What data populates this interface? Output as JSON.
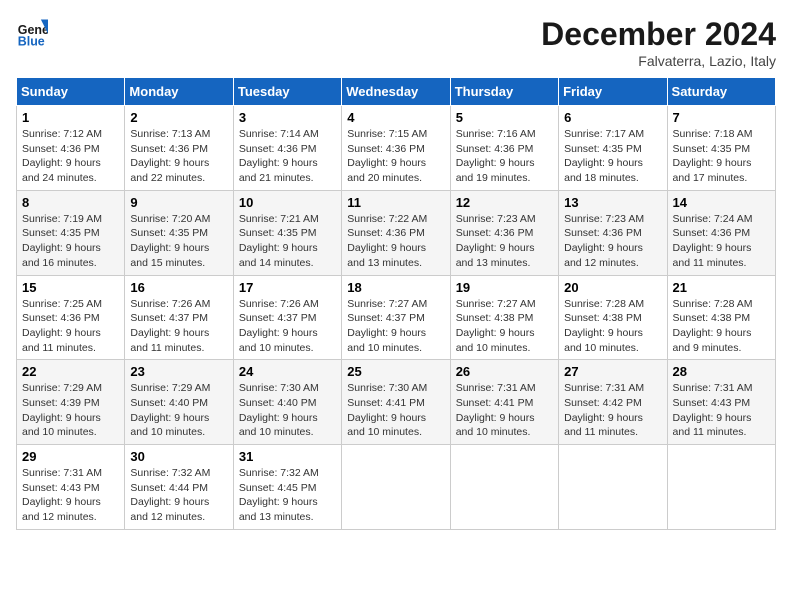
{
  "header": {
    "logo_line1": "General",
    "logo_line2": "Blue",
    "month": "December 2024",
    "location": "Falvaterra, Lazio, Italy"
  },
  "weekdays": [
    "Sunday",
    "Monday",
    "Tuesday",
    "Wednesday",
    "Thursday",
    "Friday",
    "Saturday"
  ],
  "weeks": [
    [
      {
        "day": "1",
        "sunrise": "7:12 AM",
        "sunset": "4:36 PM",
        "daylight": "9 hours and 24 minutes."
      },
      {
        "day": "2",
        "sunrise": "7:13 AM",
        "sunset": "4:36 PM",
        "daylight": "9 hours and 22 minutes."
      },
      {
        "day": "3",
        "sunrise": "7:14 AM",
        "sunset": "4:36 PM",
        "daylight": "9 hours and 21 minutes."
      },
      {
        "day": "4",
        "sunrise": "7:15 AM",
        "sunset": "4:36 PM",
        "daylight": "9 hours and 20 minutes."
      },
      {
        "day": "5",
        "sunrise": "7:16 AM",
        "sunset": "4:36 PM",
        "daylight": "9 hours and 19 minutes."
      },
      {
        "day": "6",
        "sunrise": "7:17 AM",
        "sunset": "4:35 PM",
        "daylight": "9 hours and 18 minutes."
      },
      {
        "day": "7",
        "sunrise": "7:18 AM",
        "sunset": "4:35 PM",
        "daylight": "9 hours and 17 minutes."
      }
    ],
    [
      {
        "day": "8",
        "sunrise": "7:19 AM",
        "sunset": "4:35 PM",
        "daylight": "9 hours and 16 minutes."
      },
      {
        "day": "9",
        "sunrise": "7:20 AM",
        "sunset": "4:35 PM",
        "daylight": "9 hours and 15 minutes."
      },
      {
        "day": "10",
        "sunrise": "7:21 AM",
        "sunset": "4:35 PM",
        "daylight": "9 hours and 14 minutes."
      },
      {
        "day": "11",
        "sunrise": "7:22 AM",
        "sunset": "4:36 PM",
        "daylight": "9 hours and 13 minutes."
      },
      {
        "day": "12",
        "sunrise": "7:23 AM",
        "sunset": "4:36 PM",
        "daylight": "9 hours and 13 minutes."
      },
      {
        "day": "13",
        "sunrise": "7:23 AM",
        "sunset": "4:36 PM",
        "daylight": "9 hours and 12 minutes."
      },
      {
        "day": "14",
        "sunrise": "7:24 AM",
        "sunset": "4:36 PM",
        "daylight": "9 hours and 11 minutes."
      }
    ],
    [
      {
        "day": "15",
        "sunrise": "7:25 AM",
        "sunset": "4:36 PM",
        "daylight": "9 hours and 11 minutes."
      },
      {
        "day": "16",
        "sunrise": "7:26 AM",
        "sunset": "4:37 PM",
        "daylight": "9 hours and 11 minutes."
      },
      {
        "day": "17",
        "sunrise": "7:26 AM",
        "sunset": "4:37 PM",
        "daylight": "9 hours and 10 minutes."
      },
      {
        "day": "18",
        "sunrise": "7:27 AM",
        "sunset": "4:37 PM",
        "daylight": "9 hours and 10 minutes."
      },
      {
        "day": "19",
        "sunrise": "7:27 AM",
        "sunset": "4:38 PM",
        "daylight": "9 hours and 10 minutes."
      },
      {
        "day": "20",
        "sunrise": "7:28 AM",
        "sunset": "4:38 PM",
        "daylight": "9 hours and 10 minutes."
      },
      {
        "day": "21",
        "sunrise": "7:28 AM",
        "sunset": "4:38 PM",
        "daylight": "9 hours and 9 minutes."
      }
    ],
    [
      {
        "day": "22",
        "sunrise": "7:29 AM",
        "sunset": "4:39 PM",
        "daylight": "9 hours and 10 minutes."
      },
      {
        "day": "23",
        "sunrise": "7:29 AM",
        "sunset": "4:40 PM",
        "daylight": "9 hours and 10 minutes."
      },
      {
        "day": "24",
        "sunrise": "7:30 AM",
        "sunset": "4:40 PM",
        "daylight": "9 hours and 10 minutes."
      },
      {
        "day": "25",
        "sunrise": "7:30 AM",
        "sunset": "4:41 PM",
        "daylight": "9 hours and 10 minutes."
      },
      {
        "day": "26",
        "sunrise": "7:31 AM",
        "sunset": "4:41 PM",
        "daylight": "9 hours and 10 minutes."
      },
      {
        "day": "27",
        "sunrise": "7:31 AM",
        "sunset": "4:42 PM",
        "daylight": "9 hours and 11 minutes."
      },
      {
        "day": "28",
        "sunrise": "7:31 AM",
        "sunset": "4:43 PM",
        "daylight": "9 hours and 11 minutes."
      }
    ],
    [
      {
        "day": "29",
        "sunrise": "7:31 AM",
        "sunset": "4:43 PM",
        "daylight": "9 hours and 12 minutes."
      },
      {
        "day": "30",
        "sunrise": "7:32 AM",
        "sunset": "4:44 PM",
        "daylight": "9 hours and 12 minutes."
      },
      {
        "day": "31",
        "sunrise": "7:32 AM",
        "sunset": "4:45 PM",
        "daylight": "9 hours and 13 minutes."
      },
      null,
      null,
      null,
      null
    ]
  ]
}
